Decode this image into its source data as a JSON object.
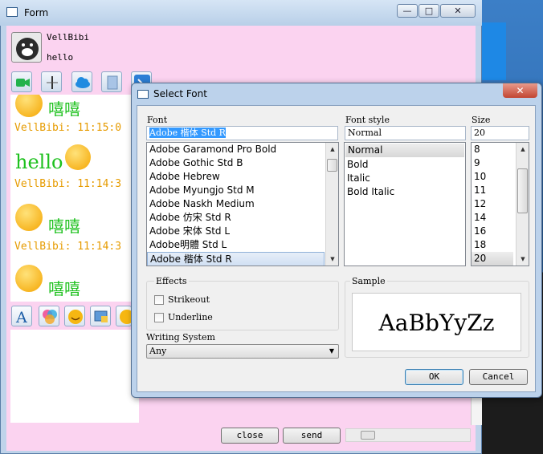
{
  "form_window": {
    "title": "Form",
    "buttons": {
      "minimize": "—",
      "maximize": "□",
      "close": "✕"
    }
  },
  "profile": {
    "name": "VellBibi",
    "signature": "hello"
  },
  "toolbar_icons": [
    "video-call-icon",
    "audio-icon",
    "cloud-icon",
    "file-icon",
    "more-icon"
  ],
  "chat": {
    "messages": [
      {
        "text": "嘻嘻",
        "meta": "VellBibi:  11:15:0"
      },
      {
        "text": "hello",
        "meta": "VellBibi:  11:14:3"
      },
      {
        "text": "嘻嘻",
        "meta": "VellBibi:  11:14:3"
      },
      {
        "text": "嘻嘻",
        "meta": ""
      }
    ]
  },
  "format_icons": [
    "font-icon",
    "color-icon",
    "emoji-icon",
    "screenshot-icon",
    "emoji2-icon"
  ],
  "actions": {
    "close": "close",
    "send": "send"
  },
  "dialog": {
    "title": "Select Font",
    "close": "✕",
    "font_label": "Font",
    "font_value": "Adobe 楷体 Std R",
    "fonts": [
      "Adobe Garamond Pro Bold",
      "Adobe Gothic Std B",
      "Adobe Hebrew",
      "Adobe Myungjo Std M",
      "Adobe Naskh Medium",
      "Adobe 仿宋 Std R",
      "Adobe 宋体 Std L",
      "Adobe明體 Std L",
      "Adobe 楷体 Std R"
    ],
    "style_label": "Font style",
    "style_value": "Normal",
    "styles": [
      "Normal",
      "Bold",
      "Italic",
      "Bold Italic"
    ],
    "size_label": "Size",
    "size_value": "20",
    "sizes": [
      "8",
      "9",
      "10",
      "11",
      "12",
      "14",
      "16",
      "18",
      "20"
    ],
    "effects_label": "Effects",
    "strikeout_label": "Strikeout",
    "underline_label": "Underline",
    "sample_label": "Sample",
    "sample_text": "AaBbYyZz",
    "writing_system_label": "Writing System",
    "writing_system_value": "Any",
    "ok": "OK",
    "cancel": "Cancel"
  }
}
